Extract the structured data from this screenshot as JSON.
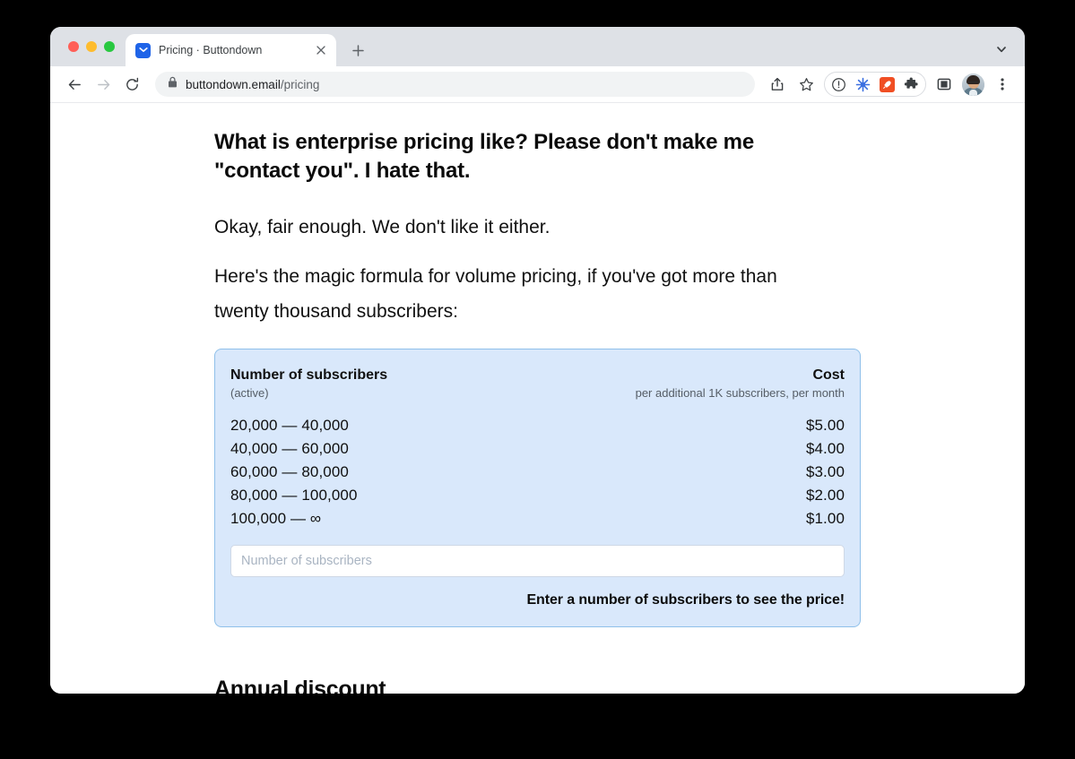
{
  "window": {
    "traffic_lights": [
      "close",
      "minimize",
      "maximize"
    ]
  },
  "browser": {
    "tab": {
      "title": "Pricing · Buttondown",
      "favicon_name": "buttondown-envelope-icon",
      "close_label": "×"
    },
    "new_tab_label": "+",
    "tab_search_name": "chevron-down-icon",
    "toolbar": {
      "back_name": "back-arrow-icon",
      "forward_name": "forward-arrow-icon",
      "reload_name": "reload-icon",
      "lock_name": "lock-icon",
      "url_domain": "buttondown.email",
      "url_path": "/pricing",
      "share_name": "share-icon",
      "bookmark_name": "star-icon",
      "extensions": [
        {
          "name": "info-circle-icon"
        },
        {
          "name": "asterisk-burst-icon"
        },
        {
          "name": "rocket-icon"
        },
        {
          "name": "puzzle-piece-icon"
        }
      ],
      "sidebar_name": "side-panel-icon",
      "avatar_name": "profile-avatar",
      "menu_name": "three-dot-menu-icon"
    }
  },
  "page": {
    "question_heading": "What is enterprise pricing like? Please don't make me \"contact you\". I hate that.",
    "paragraphs": [
      "Okay, fair enough. We don't like it either.",
      "Here's the magic formula for volume pricing, if you've got more than twenty thousand subscribers:"
    ],
    "pricing_card": {
      "header": {
        "left_main": "Number of subscribers",
        "left_sub": "(active)",
        "right_main": "Cost",
        "right_sub": "per additional 1K subscribers, per month"
      },
      "rows": [
        {
          "range": "20,000 — 40,000",
          "cost": "$5.00"
        },
        {
          "range": "40,000 — 60,000",
          "cost": "$4.00"
        },
        {
          "range": "60,000 — 80,000",
          "cost": "$3.00"
        },
        {
          "range": "80,000 — 100,000",
          "cost": "$2.00"
        },
        {
          "range": "100,000 — ∞",
          "cost": "$1.00"
        }
      ],
      "input": {
        "placeholder": "Number of subscribers",
        "value": ""
      },
      "result_text": "Enter a number of subscribers to see the price!"
    },
    "section_heading": "Annual discount"
  },
  "colors": {
    "card_background": "#d9e8fb",
    "card_border": "#8fc0ea",
    "tabstrip": "#dee1e6",
    "favicon_blue": "#1f64e8",
    "rocket_orange": "#f04e23",
    "asterisk_blue": "#3b6fe0"
  }
}
